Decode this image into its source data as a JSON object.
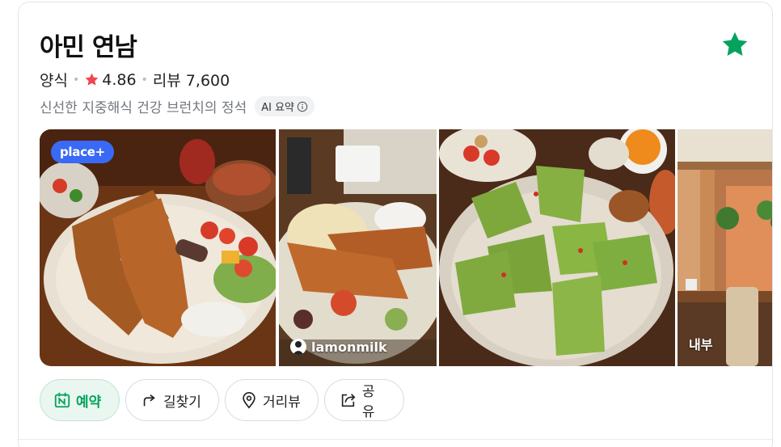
{
  "place": {
    "name": "아민 연남",
    "category": "양식",
    "rating": "4.86",
    "reviews_label": "리뷰 7,600",
    "summary": "신선한 지중해식 건강 브런치의 정석",
    "ai_badge": "AI 요약"
  },
  "gallery": {
    "badge": "place+",
    "credit": "lamonmilk",
    "interior_label": "내부"
  },
  "actions": {
    "reserve": "예약",
    "directions": "길찾기",
    "street_view": "거리뷰",
    "share": "공유"
  },
  "icons": [
    "favorite-star-icon",
    "rating-star-icon",
    "info-icon",
    "naver-calendar-icon",
    "route-arrow-icon",
    "location-pin-icon",
    "share-icon"
  ],
  "colors": {
    "accent_green": "#03a35c",
    "star_red": "#f0464e",
    "badge_blue": "#3a6af5"
  }
}
